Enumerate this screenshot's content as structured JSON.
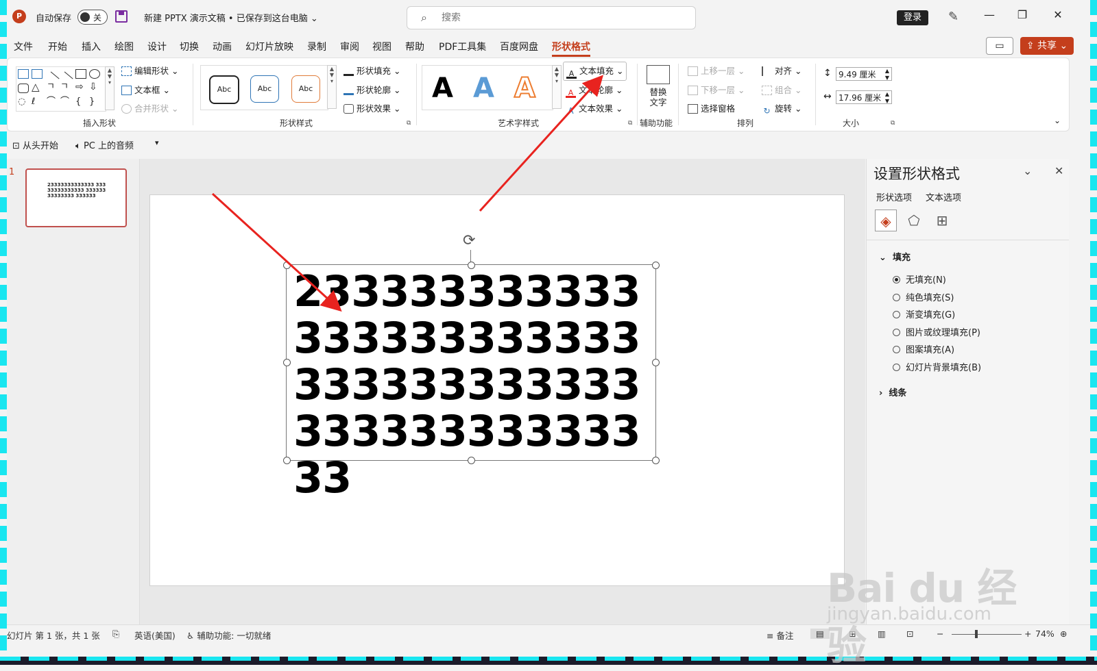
{
  "titlebar": {
    "autosave_label": "自动保存",
    "autosave_state": "关",
    "doc_title": "新建 PPTX 演示文稿 • 已保存到这台电脑 ⌄",
    "search_placeholder": "搜索",
    "login_label": "登录"
  },
  "tabs": [
    "文件",
    "开始",
    "插入",
    "绘图",
    "设计",
    "切换",
    "动画",
    "幻灯片放映",
    "录制",
    "审阅",
    "视图",
    "帮助",
    "PDF工具集",
    "百度网盘",
    "形状格式"
  ],
  "share_label": "共享",
  "ribbon": {
    "insert_shapes": {
      "label": "插入形状",
      "edit_shape": "编辑形状 ⌄",
      "text_box": "文本框 ⌄",
      "merge_shapes": "合并形状 ⌄"
    },
    "shape_styles": {
      "label": "形状样式",
      "sample": "Abc",
      "fill": "形状填充 ⌄",
      "outline": "形状轮廓 ⌄",
      "effects": "形状效果 ⌄"
    },
    "wordart": {
      "label": "艺术字样式",
      "sample": "A",
      "text_fill": "文本填充 ⌄",
      "text_outline": "文本轮廓 ⌄",
      "text_effects": "文本效果 ⌄"
    },
    "accessibility": {
      "label": "辅助功能",
      "alt_text": "替换文字"
    },
    "arrange": {
      "label": "排列",
      "bring_forward": "上移一层 ⌄",
      "send_backward": "下移一层 ⌄",
      "selection_pane": "选择窗格",
      "align": "对齐 ⌄",
      "group": "组合 ⌄",
      "rotate": "旋转 ⌄"
    },
    "size": {
      "label": "大小",
      "height": "9.49 厘米",
      "width": "17.96 厘米"
    }
  },
  "qat": {
    "from_start": "从头开始",
    "audio": "PC 上的音频"
  },
  "thumbnail": {
    "number": "1",
    "text": "23333333333333 33333333333333 33333333333333 333333"
  },
  "slide": {
    "text": "23333333333333333333333333333333333333333333333333"
  },
  "format_pane": {
    "title": "设置形状格式",
    "tab_shape": "形状选项",
    "tab_text": "文本选项",
    "fill_section": "填充",
    "line_section": "线条",
    "fill_options": [
      "无填充(N)",
      "纯色填充(S)",
      "渐变填充(G)",
      "图片或纹理填充(P)",
      "图案填充(A)",
      "幻灯片背景填充(B)"
    ]
  },
  "statusbar": {
    "slide_info": "幻灯片 第 1 张，共 1 张",
    "language": "英语(美国)",
    "accessibility": "辅助功能: 一切就绪",
    "notes": "备注",
    "zoom": "74%"
  },
  "watermark": {
    "brand": "Bai du 经验",
    "url": "jingyan.baidu.com"
  },
  "colors": {
    "accent": "#c43e1c",
    "arrow": "#e8231f",
    "frame": "#19e6f0"
  }
}
